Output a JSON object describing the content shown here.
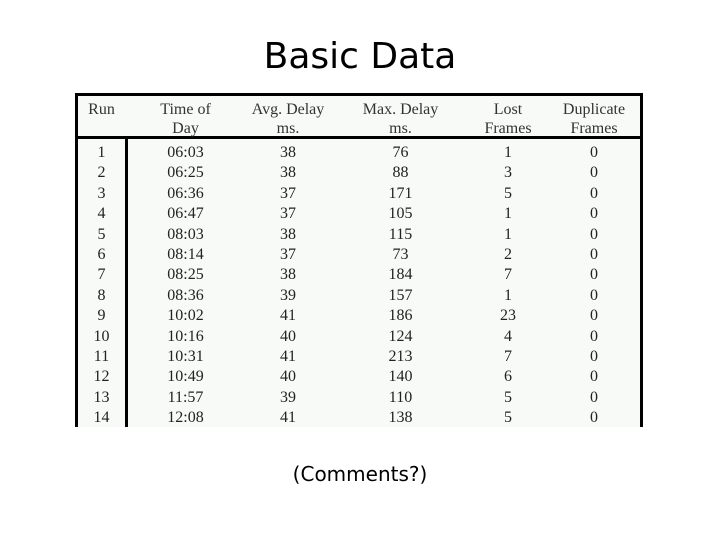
{
  "slide": {
    "title": "Basic Data",
    "comment": "(Comments?)"
  },
  "table": {
    "headers": [
      {
        "line1": "Run",
        "line2": ""
      },
      {
        "line1": "Time of",
        "line2": "Day"
      },
      {
        "line1": "Avg. Delay",
        "line2": "ms."
      },
      {
        "line1": "Max. Delay",
        "line2": "ms."
      },
      {
        "line1": "Lost",
        "line2": "Frames"
      },
      {
        "line1": "Duplicate",
        "line2": "Frames"
      }
    ],
    "rows": [
      [
        "1",
        "06:03",
        "38",
        "76",
        "1",
        "0"
      ],
      [
        "2",
        "06:25",
        "38",
        "88",
        "3",
        "0"
      ],
      [
        "3",
        "06:36",
        "37",
        "171",
        "5",
        "0"
      ],
      [
        "4",
        "06:47",
        "37",
        "105",
        "1",
        "0"
      ],
      [
        "5",
        "08:03",
        "38",
        "115",
        "1",
        "0"
      ],
      [
        "6",
        "08:14",
        "37",
        "73",
        "2",
        "0"
      ],
      [
        "7",
        "08:25",
        "38",
        "184",
        "7",
        "0"
      ],
      [
        "8",
        "08:36",
        "39",
        "157",
        "1",
        "0"
      ],
      [
        "9",
        "10:02",
        "41",
        "186",
        "23",
        "0"
      ],
      [
        "10",
        "10:16",
        "40",
        "124",
        "4",
        "0"
      ],
      [
        "11",
        "10:31",
        "41",
        "213",
        "7",
        "0"
      ],
      [
        "12",
        "10:49",
        "40",
        "140",
        "6",
        "0"
      ],
      [
        "13",
        "11:57",
        "39",
        "110",
        "5",
        "0"
      ],
      [
        "14",
        "12:08",
        "41",
        "138",
        "5",
        "0"
      ]
    ]
  }
}
